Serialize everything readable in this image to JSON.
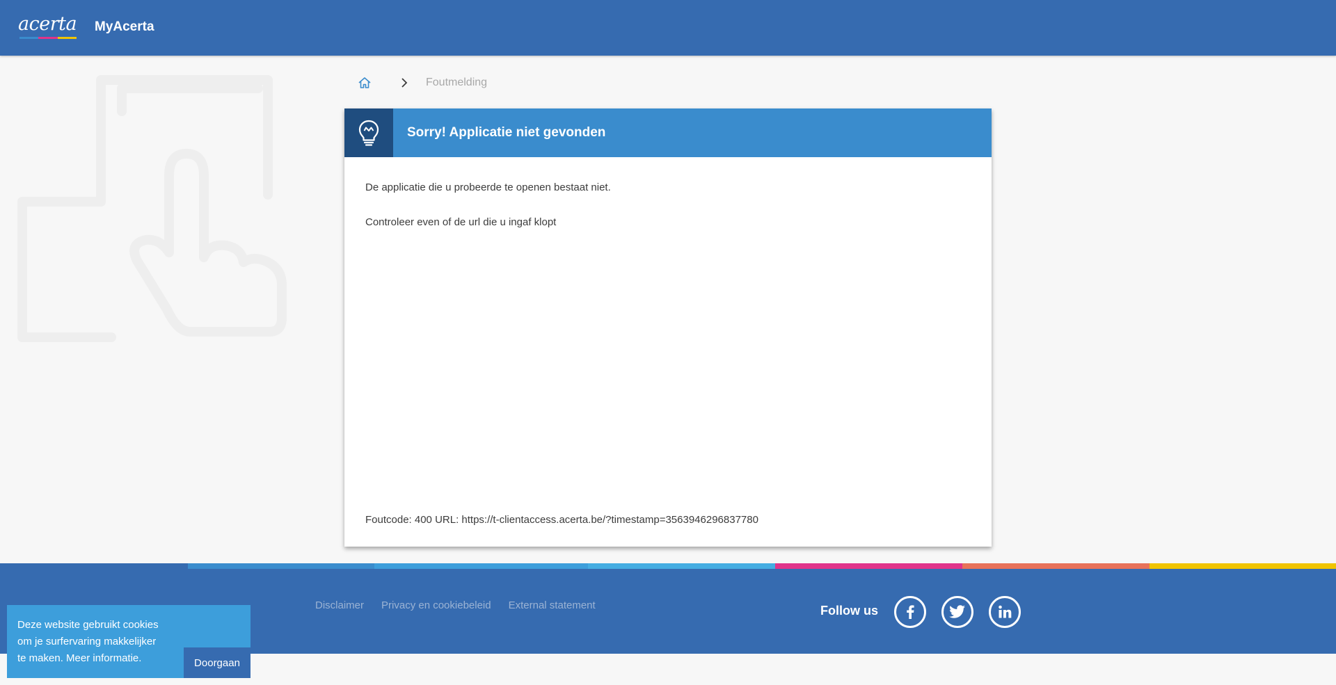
{
  "header": {
    "logo_text": "acerta",
    "app_title": "MyAcerta",
    "logo_stripe_colors": [
      "#3a8ccd",
      "#e0348a",
      "#f0c400"
    ]
  },
  "breadcrumb": {
    "home_icon": "home-icon",
    "separator_icon": "chevron-right-icon",
    "current": "Foutmelding"
  },
  "error_card": {
    "icon": "lightbulb-icon",
    "title": "Sorry! Applicatie niet gevonden",
    "message_1": "De applicatie die u probeerde te openen bestaat niet.",
    "message_2": "Controleer even of de url die u ingaf klopt",
    "error_code": "Foutcode: 400 URL: https://t-clientaccess.acerta.be/?timestamp=3563946296837780"
  },
  "footer": {
    "links": [
      "Disclaimer",
      "Privacy en cookiebeleid",
      "External statement"
    ],
    "follow_us": "Follow us",
    "social_icons": [
      "facebook-icon",
      "twitter-icon",
      "linkedin-icon"
    ],
    "strip_colors": [
      "#366bb0",
      "#3a8ccd",
      "#3d9edb",
      "#45ade2",
      "#e0348a",
      "#e8725a",
      "#f0c400"
    ]
  },
  "cookie_banner": {
    "text_lines": [
      "Deze website gebruikt cookies",
      "om je surfervaring makkelijker",
      "te maken. "
    ],
    "more_link": "Meer informatie.",
    "button": "Doorgaan"
  },
  "colors": {
    "header_bg": "#366bb0",
    "card_header_bg": "#3a8ccd",
    "card_icon_bg": "#1f4d7f",
    "page_bg": "#f7f7f7",
    "cookie_bg": "#3d9edb"
  }
}
